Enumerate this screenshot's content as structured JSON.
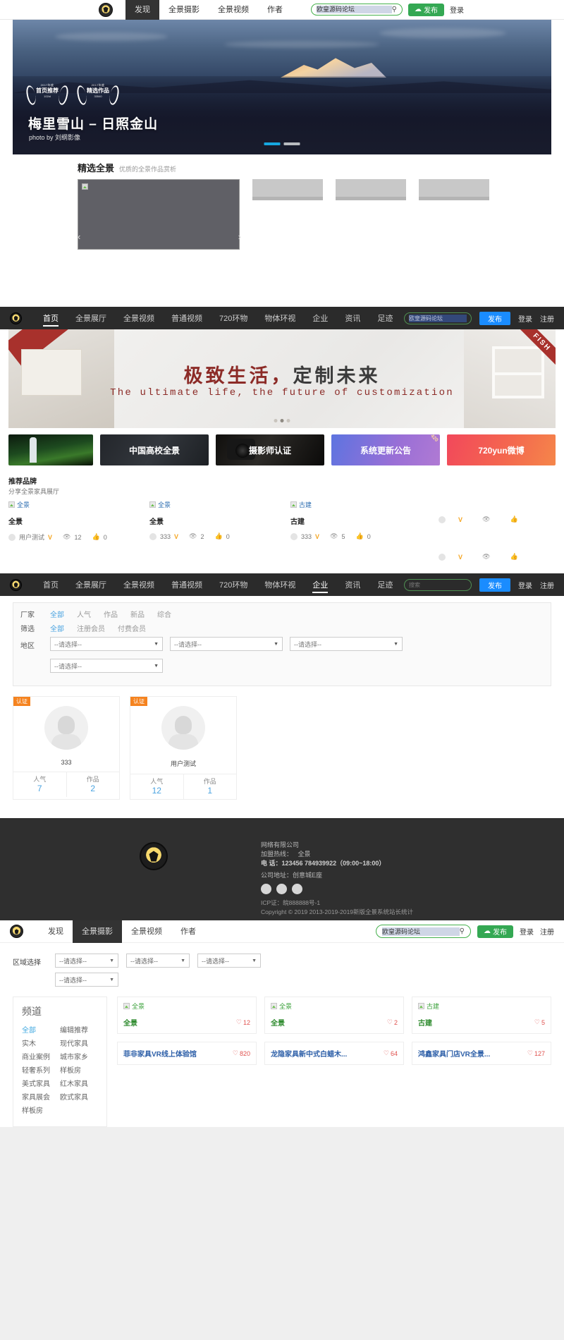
{
  "section1": {
    "nav": {
      "items": [
        {
          "label": "发现",
          "active": true
        },
        {
          "label": "全景摄影",
          "active": false
        },
        {
          "label": "全景视频",
          "active": false
        },
        {
          "label": "作者",
          "active": false
        }
      ],
      "search_value": "欧皇源码论坛",
      "search_icon": "search-icon",
      "publish_label": "发布",
      "login_label": "登录"
    },
    "hero": {
      "badges": [
        {
          "year": "2017年度",
          "name": "首页推荐",
          "no": "102id"
        },
        {
          "year": "2017年度",
          "name": "精选作品",
          "no": "33540"
        }
      ],
      "title": "梅里雪山 – 日照金山",
      "byline": "photo by 刘纲影像"
    },
    "featured": {
      "title": "精选全景",
      "subtitle": "优质的全景作品赏析"
    }
  },
  "section2": {
    "nav": {
      "items": [
        {
          "label": "首页",
          "active": true
        },
        {
          "label": "全景展厅",
          "active": false
        },
        {
          "label": "全景视频",
          "active": false
        },
        {
          "label": "普通视频",
          "active": false
        },
        {
          "label": "720环物",
          "active": false
        },
        {
          "label": "物体环视",
          "active": false
        },
        {
          "label": "企业",
          "active": false
        },
        {
          "label": "资讯",
          "active": false
        },
        {
          "label": "足迹",
          "active": false
        }
      ],
      "search_value": "欧皇源码论坛",
      "publish_label": "发布",
      "login_label": "登录",
      "register_label": "注册"
    },
    "banner": {
      "cn_red": "极致生活，",
      "cn_dark": "定制未来",
      "en": "The ultimate life, the future of customization",
      "corner_tag": "FISH"
    },
    "cards": [
      {
        "label": "",
        "kind": "rocket"
      },
      {
        "label": "中国高校全景",
        "kind": "dark"
      },
      {
        "label": "摄影师认证",
        "kind": "camera"
      },
      {
        "label": "系统更新公告",
        "kind": "purple",
        "corner": "420"
      },
      {
        "label": "720yun微博",
        "kind": "orange"
      }
    ],
    "brand": {
      "title": "推荐品牌",
      "subtitle": "分享全景家具展厅"
    },
    "works": [
      {
        "alt": "全景",
        "title": "全景",
        "author": "用户测试",
        "verified": "V",
        "views": "12",
        "likes": "0"
      },
      {
        "alt": "全景",
        "title": "全景",
        "author": "333",
        "verified": "V",
        "views": "2",
        "likes": "0"
      },
      {
        "alt": "古建",
        "title": "古建",
        "author": "333",
        "verified": "V",
        "views": "5",
        "likes": "0"
      }
    ]
  },
  "section3": {
    "nav": {
      "items": [
        {
          "label": "首页",
          "active": false
        },
        {
          "label": "全景展厅",
          "active": false
        },
        {
          "label": "全景视频",
          "active": false
        },
        {
          "label": "普通视频",
          "active": false
        },
        {
          "label": "720环物",
          "active": false
        },
        {
          "label": "物体环视",
          "active": false
        },
        {
          "label": "企业",
          "active": true
        },
        {
          "label": "资讯",
          "active": false
        },
        {
          "label": "足迹",
          "active": false
        }
      ],
      "search_placeholder": "搜索",
      "publish_label": "发布",
      "login_label": "登录",
      "register_label": "注册"
    },
    "filters": {
      "row1_label": "厂家",
      "row1_options": [
        {
          "label": "全部",
          "active": true
        },
        {
          "label": "人气",
          "active": false
        },
        {
          "label": "作品",
          "active": false
        },
        {
          "label": "新品",
          "active": false
        },
        {
          "label": "综合",
          "active": false
        }
      ],
      "row2_label": "筛选",
      "row2_options": [
        {
          "label": "全部",
          "active": true
        },
        {
          "label": "注册会员",
          "active": false
        },
        {
          "label": "付费会员",
          "active": false
        }
      ],
      "row3_label": "地区",
      "selects": [
        "--请选择--",
        "--请选择--",
        "--请选择--",
        "--请选择--"
      ]
    },
    "users": [
      {
        "badge": "认证",
        "name": "333",
        "stat1_label": "人气",
        "stat1_value": "7",
        "stat2_label": "作品",
        "stat2_value": "2"
      },
      {
        "badge": "认证",
        "name": "用户测试",
        "stat1_label": "人气",
        "stat1_value": "12",
        "stat2_label": "作品",
        "stat2_value": "1"
      }
    ]
  },
  "footer": {
    "company": "网络有限公司",
    "hotline_label": "加盟热线：",
    "hotline_value": "全景",
    "phone": "电 话：123456 784939922（09:00~18:00）",
    "address": "公司地址：创意城E座",
    "socials": [
      "wechat-icon",
      "weibo-icon",
      "qq-icon"
    ],
    "icp": "ICP证：皖888888号-1",
    "copyright": "Copyright © 2019 2013-2019-2019新版全景系统站长统计"
  },
  "section4": {
    "nav": {
      "items": [
        {
          "label": "发现",
          "active": false
        },
        {
          "label": "全景摄影",
          "active": true
        },
        {
          "label": "全景视频",
          "active": false
        },
        {
          "label": "作者",
          "active": false
        }
      ],
      "search_value": "欧皇源码论坛",
      "publish_label": "发布",
      "login_label": "登录",
      "register_label": "注册"
    },
    "area": {
      "label": "区域选择",
      "selects": [
        "--请选择--",
        "--请选择--",
        "--请选择--",
        "--请选择--"
      ]
    },
    "channel": {
      "title": "频道",
      "items": [
        {
          "label": "全部",
          "active": true
        },
        {
          "label": "编辑推荐",
          "active": false
        },
        {
          "label": "实木",
          "active": false
        },
        {
          "label": "现代家具",
          "active": false
        },
        {
          "label": "商业案例",
          "active": false
        },
        {
          "label": "城市家乡",
          "active": false
        },
        {
          "label": "轻奢系列",
          "active": false
        },
        {
          "label": "样板房",
          "active": false
        },
        {
          "label": "美式家具",
          "active": false
        },
        {
          "label": "红木家具",
          "active": false
        },
        {
          "label": "家具展会",
          "active": false
        },
        {
          "label": "欧式家具",
          "active": false
        },
        {
          "label": "样板房",
          "active": false
        }
      ]
    },
    "gallery_row1": [
      {
        "alt": "全景",
        "title": "全景",
        "likes": "12"
      },
      {
        "alt": "全景",
        "title": "全景",
        "likes": "2"
      },
      {
        "alt": "古建",
        "title": "古建",
        "likes": "5"
      }
    ],
    "gallery_row2": [
      {
        "title": "菲非家具VR线上体验馆",
        "likes": "820"
      },
      {
        "title": "龙隐家具新中式白蜡木...",
        "likes": "64"
      },
      {
        "title": "鸿鑫家具门店VR全景...",
        "likes": "127"
      }
    ]
  }
}
